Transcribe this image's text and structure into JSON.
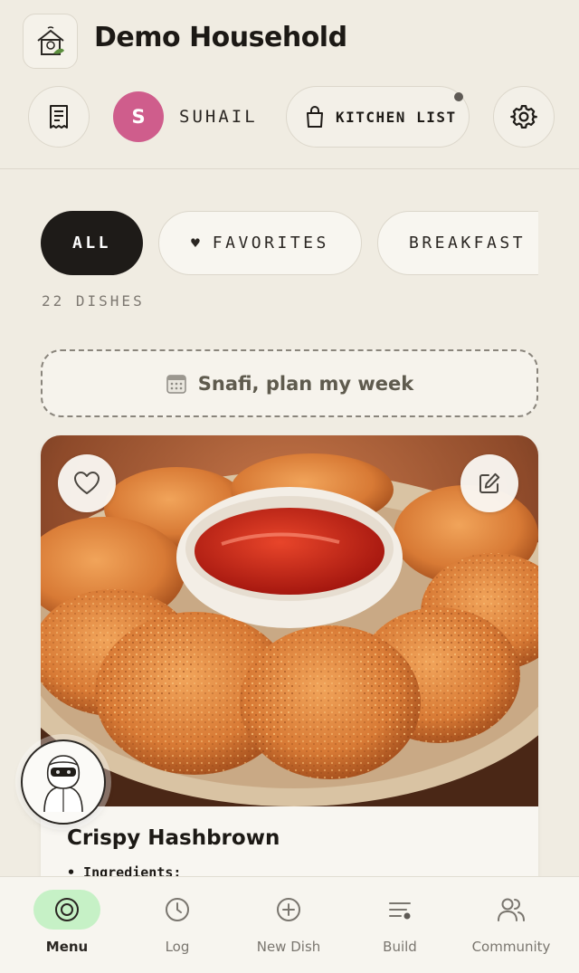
{
  "header": {
    "household_name": "Demo Household",
    "logo_icon": "house-leaf-logo",
    "receipt_icon": "receipt-icon",
    "user": {
      "initial": "S",
      "name": "SUHAIL",
      "avatar_color": "#cf5d8c"
    },
    "kitchen_list": {
      "label": "KITCHEN LIST",
      "icon": "shopping-bag-icon",
      "has_notification": true
    },
    "settings_icon": "gear-icon"
  },
  "filters": {
    "chips": [
      {
        "label": "ALL",
        "active": true
      },
      {
        "label": "FAVORITES",
        "icon": "heart",
        "glyph": "♥",
        "active": false
      },
      {
        "label": "BREAKFAST",
        "active": false
      }
    ],
    "count_label": "22 DISHES"
  },
  "plan_button": {
    "label": "Snafi, plan my week",
    "icon": "calendar-icon"
  },
  "dish_card": {
    "title": "Crispy Hashbrown",
    "subtitle": "• Ingredients:",
    "image_description_icon": "hashbrown-photo",
    "favorite_icon": "heart-outline-icon",
    "edit_icon": "edit-icon"
  },
  "assistant": {
    "icon": "robot-assistant-icon"
  },
  "bottom_nav": {
    "items": [
      {
        "label": "Menu",
        "icon": "menu-target-icon",
        "active": true
      },
      {
        "label": "Log",
        "icon": "clock-icon",
        "active": false
      },
      {
        "label": "New Dish",
        "icon": "plus-circle-icon",
        "active": false
      },
      {
        "label": "Build",
        "icon": "build-lines-icon",
        "active": false
      },
      {
        "label": "Community",
        "icon": "people-icon",
        "active": false
      }
    ]
  },
  "colors": {
    "background": "#f0ece2",
    "active_chip": "#1e1b18",
    "active_nav": "#c6f1c6",
    "avatar": "#cf5d8c"
  }
}
